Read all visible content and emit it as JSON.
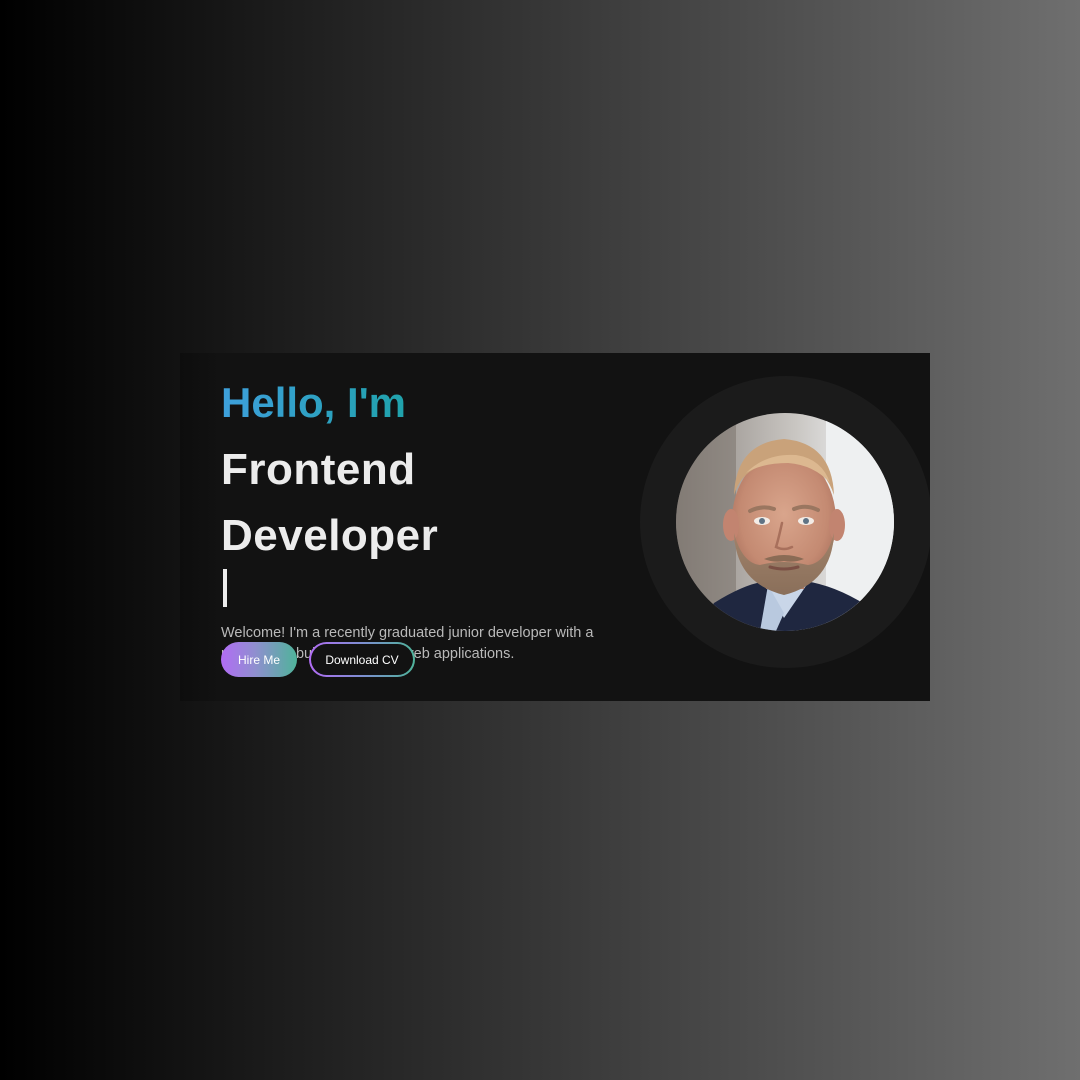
{
  "hero": {
    "greeting": "Hello, I'm",
    "role_line1": "Frontend",
    "role_line2": "Developer",
    "intro": "Welcome! I'm a recently graduated junior developer with a passion for building modern web applications.",
    "hire_label": "Hire Me",
    "download_label": "Download CV"
  },
  "colors": {
    "greeting_gradient_start": "#3ea0dc",
    "greeting_gradient_end": "#0e9d6a",
    "button_gradient_start": "#b26cf5",
    "button_gradient_end": "#4fb39a",
    "card_background": "#121212"
  },
  "icons": {
    "portrait": "profile-photo"
  }
}
